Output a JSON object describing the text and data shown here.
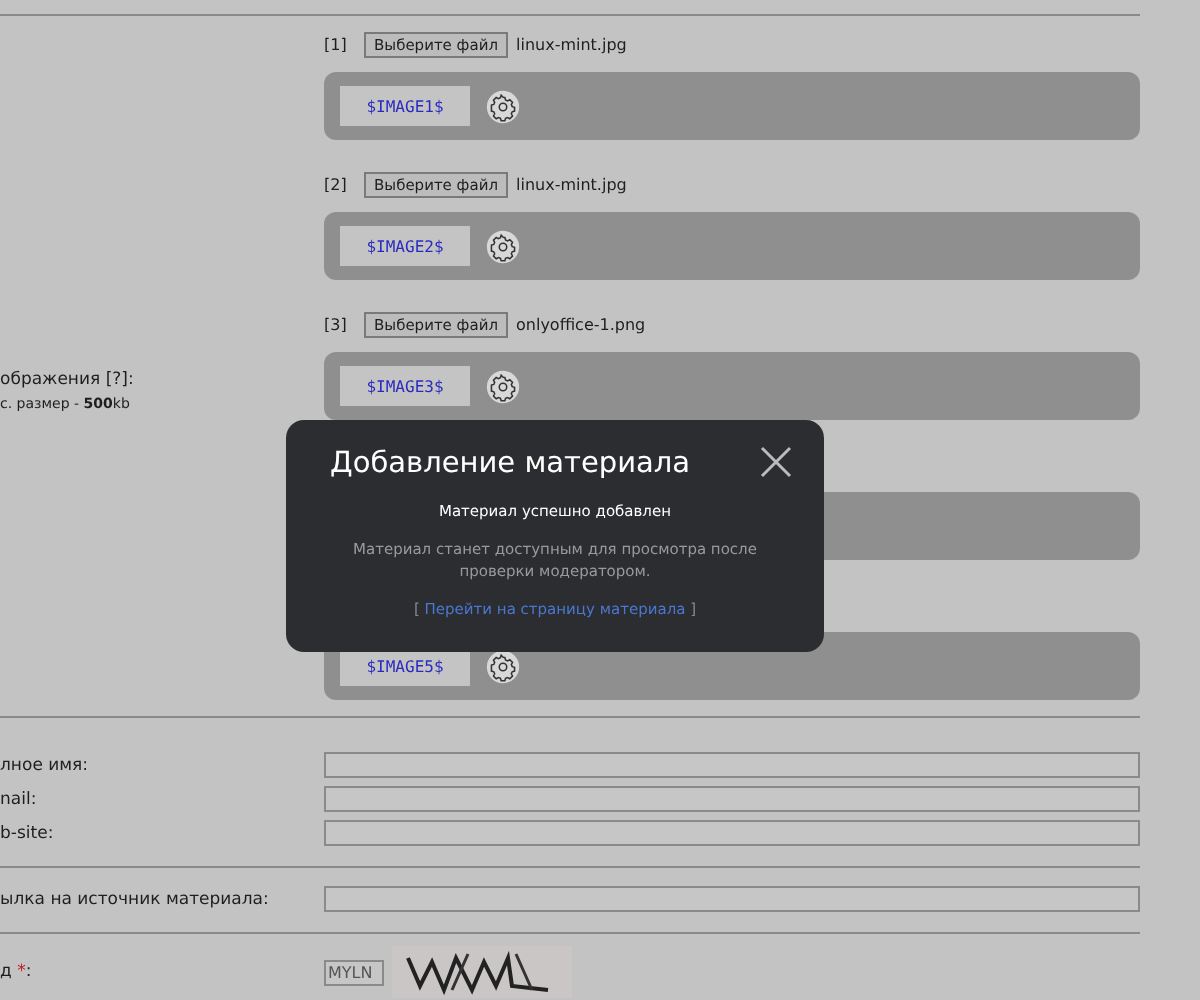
{
  "image_label": {
    "title": "ображения [?]:",
    "hint": "с. размер - **500**kb"
  },
  "uploads": [
    {
      "kind": "full",
      "index": "[1]",
      "button": "Выберите файл",
      "file": "linux-mint.jpg",
      "code": "$IMAGE1$"
    },
    {
      "kind": "full",
      "index": "[2]",
      "button": "Выберите файл",
      "file": "linux-mint.jpg",
      "code": "$IMAGE2$"
    },
    {
      "kind": "full",
      "index": "[3]",
      "button": "Выберите файл",
      "file": "onlyoffice-1.png",
      "code": "$IMAGE3$"
    },
    {
      "kind": "covered"
    },
    {
      "kind": "panel",
      "code": "$IMAGE5$"
    }
  ],
  "contact_fields": [
    {
      "label": "лное имя:"
    },
    {
      "label": "nail:"
    },
    {
      "label": "b-site:"
    }
  ],
  "source_field": {
    "label": "ылка на источник материала:"
  },
  "captcha": {
    "label": "д ",
    "required_mark": "*",
    "colon": ":",
    "value": "MYLN"
  },
  "modal": {
    "title": "Добавление материала",
    "message": "Материал успешно добавлен",
    "note": "Материал станет доступным для просмотра после проверки модератором.",
    "link_open": "[",
    "link": "Перейти на страницу материала",
    "link_close": "]"
  }
}
